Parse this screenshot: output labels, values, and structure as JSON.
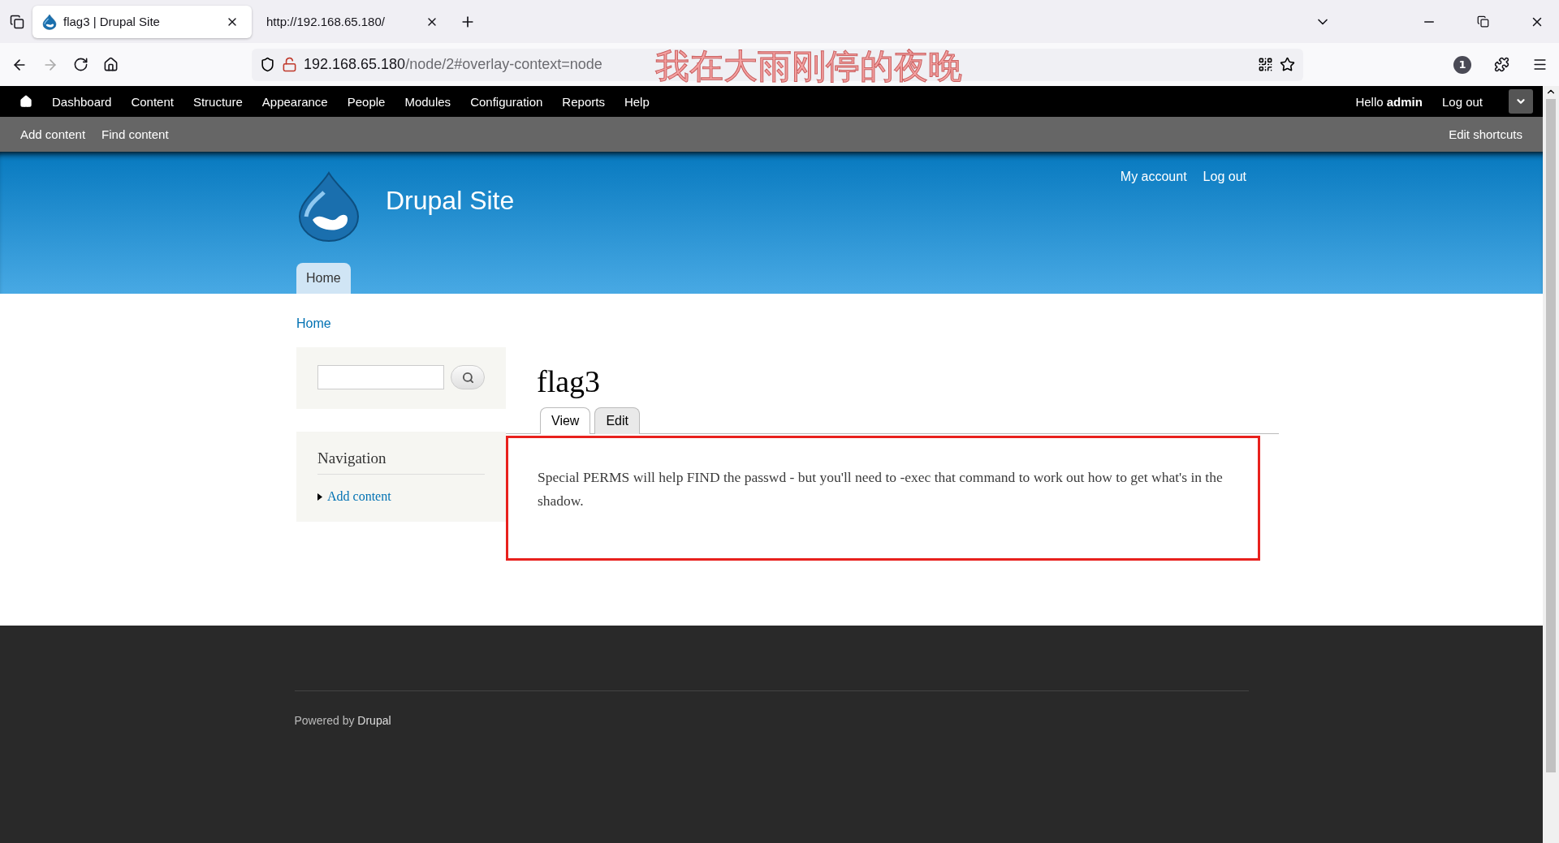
{
  "browser": {
    "tabs": [
      {
        "title": "flag3 | Drupal Site",
        "selected": true,
        "favicon": true
      },
      {
        "title": "http://192.168.65.180/",
        "selected": false,
        "favicon": false
      }
    ],
    "url": {
      "host": "192.168.65.180",
      "path": "/node/2#overlay-context=node"
    },
    "extensions_badge": "1"
  },
  "overlay_lyric": "我在大雨刚停的夜晚",
  "admin_toolbar": {
    "items": [
      "Dashboard",
      "Content",
      "Structure",
      "Appearance",
      "People",
      "Modules",
      "Configuration",
      "Reports",
      "Help"
    ],
    "greeting": "Hello",
    "user": "admin",
    "logout": "Log out"
  },
  "shortcuts": {
    "items": [
      "Add content",
      "Find content"
    ],
    "edit": "Edit shortcuts"
  },
  "header": {
    "site_name": "Drupal Site",
    "secondary_links": [
      "My account",
      "Log out"
    ],
    "main_menu": [
      {
        "label": "Home",
        "selected": true
      }
    ]
  },
  "breadcrumb": "Home",
  "sidebar": {
    "navigation": {
      "title": "Navigation",
      "items": [
        "Add content"
      ]
    }
  },
  "node": {
    "title": "flag3",
    "tabs": [
      {
        "label": "View",
        "selected": true
      },
      {
        "label": "Edit",
        "selected": false
      }
    ],
    "body": "Special PERMS will help FIND the passwd - but you'll need to -exec that command to work out how to get what's in the shadow.",
    "highlighted": true
  },
  "footer": {
    "prefix": "Powered by",
    "link": "Drupal"
  }
}
